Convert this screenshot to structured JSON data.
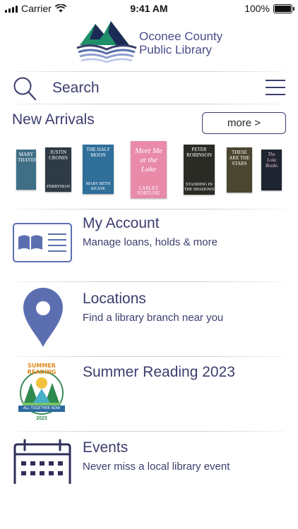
{
  "status_bar": {
    "carrier": "Carrier",
    "time": "9:41 AM",
    "battery": "100%"
  },
  "logo": {
    "line1": "Oconee County",
    "line2": "Public Library"
  },
  "search": {
    "placeholder": "Search"
  },
  "new_arrivals": {
    "title": "New Arrivals",
    "more_label": "more >",
    "books": [
      {
        "title": "MARY THAYER",
        "author": "",
        "color": "#3f6f86"
      },
      {
        "title": "JUSTIN CRONIN",
        "author": "FERRYMAN",
        "color": "#2e3a45"
      },
      {
        "title": "THE HALF MOON",
        "author": "MARY BETH KEANE",
        "color": "#2f6f9a"
      },
      {
        "title": "Meet Me at the Lake",
        "author": "CARLEY FORTUNE",
        "color": "#e88aa8"
      },
      {
        "title": "PETER ROBINSON",
        "author": "STANDING IN THE SHADOWS",
        "color": "#2b2b26"
      },
      {
        "title": "THESE ARE THE STARS",
        "author": "",
        "color": "#4a4630"
      },
      {
        "title": "The Lola Books",
        "author": "",
        "color": "#1e2430"
      }
    ]
  },
  "menu": {
    "my_account": {
      "title": "My Account",
      "subtitle": "Manage loans, holds & more"
    },
    "locations": {
      "title": "Locations",
      "subtitle": "Find a library branch near you"
    },
    "summer_reading": {
      "title": "Summer Reading 2023",
      "badge_top": "SUMMER READING",
      "badge_banner": "ALL TOGETHER NOW",
      "badge_year": "2023"
    },
    "events": {
      "title": "Events",
      "subtitle": "Never miss a local library event"
    }
  },
  "colors": {
    "brand_navy": "#3b3d6e",
    "icon_blue": "#5b6fb0",
    "logo_green": "#1f8f6a"
  }
}
